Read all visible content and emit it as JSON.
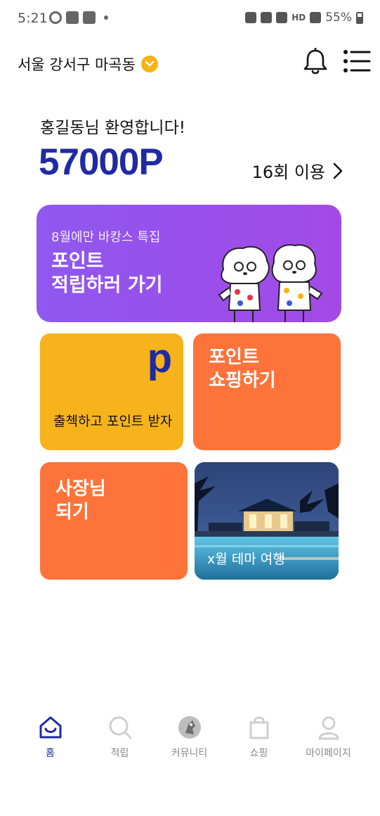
{
  "status_bar": {
    "time": "5:21",
    "battery": "55%",
    "network": "HD"
  },
  "header": {
    "location": "서울 강서구 마곡동",
    "icons": [
      "chevron-down-icon",
      "bell-icon",
      "menu-icon"
    ]
  },
  "welcome": {
    "greeting": "홍길동님 환영합니다!",
    "points": "57000P",
    "usage": "16회 이용"
  },
  "banner": {
    "subtitle": "8월에만 바캉스 특집",
    "title": "포인트\n적립하러 가기",
    "color": "#9a4fea"
  },
  "tiles": {
    "attendance": {
      "mark": "p",
      "label": "출첵하고 포인트 받자",
      "color": "#f7b31b"
    },
    "shopping": {
      "title": "포인트\n쇼핑하기",
      "color": "#fd733a"
    },
    "owner": {
      "title": "사장님\n되기",
      "color": "#fd733a"
    },
    "travel": {
      "label": "x월 테마 여행"
    }
  },
  "bottom_nav": {
    "items": [
      {
        "label": "홈",
        "icon": "home-icon",
        "active": true
      },
      {
        "label": "적립",
        "icon": "search-icon",
        "active": false
      },
      {
        "label": "커뮤니티",
        "icon": "community-icon",
        "active": false
      },
      {
        "label": "쇼핑",
        "icon": "shopping-bag-icon",
        "active": false
      },
      {
        "label": "마이페이지",
        "icon": "person-icon",
        "active": false
      }
    ]
  },
  "colors": {
    "brand_blue": "#1f2aa3",
    "accent_yellow": "#f5b416",
    "orange": "#fd733a"
  }
}
